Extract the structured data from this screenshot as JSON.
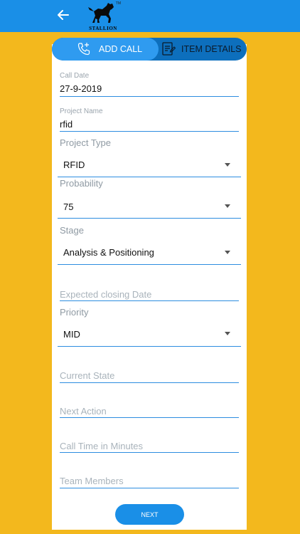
{
  "header": {
    "back_icon": "arrow-left-icon",
    "logo_text": "STALLION",
    "logo_tm": "TM",
    "color": "#1a8fe7"
  },
  "tabs": [
    {
      "label": "ADD CALL",
      "icon": "phone-add-icon",
      "active": true
    },
    {
      "label": "ITEM DETAILS",
      "icon": "document-list-icon",
      "active": false
    }
  ],
  "form": {
    "call_date": {
      "label": "Call Date",
      "value": "27-9-2019"
    },
    "project_name": {
      "label": "Project Name",
      "value": "rfid"
    },
    "project_type": {
      "label": "Project Type",
      "value": "RFID"
    },
    "probability": {
      "label": "Probability",
      "value": "75"
    },
    "stage": {
      "label": "Stage",
      "value": "Analysis & Positioning"
    },
    "expected_closing_date": {
      "placeholder": "Expected closing Date"
    },
    "priority": {
      "label": "Priority",
      "value": "MID"
    },
    "current_state": {
      "placeholder": "Current State"
    },
    "next_action": {
      "placeholder": "Next Action"
    },
    "call_time": {
      "placeholder": "Call Time in Minutes"
    },
    "team_members": {
      "placeholder": "Team Members"
    }
  },
  "next_button": {
    "label": "NEXT"
  },
  "colors": {
    "background": "#f3b81d",
    "accent": "#1a8fe7",
    "tab_bar": "#0d6fbd"
  }
}
